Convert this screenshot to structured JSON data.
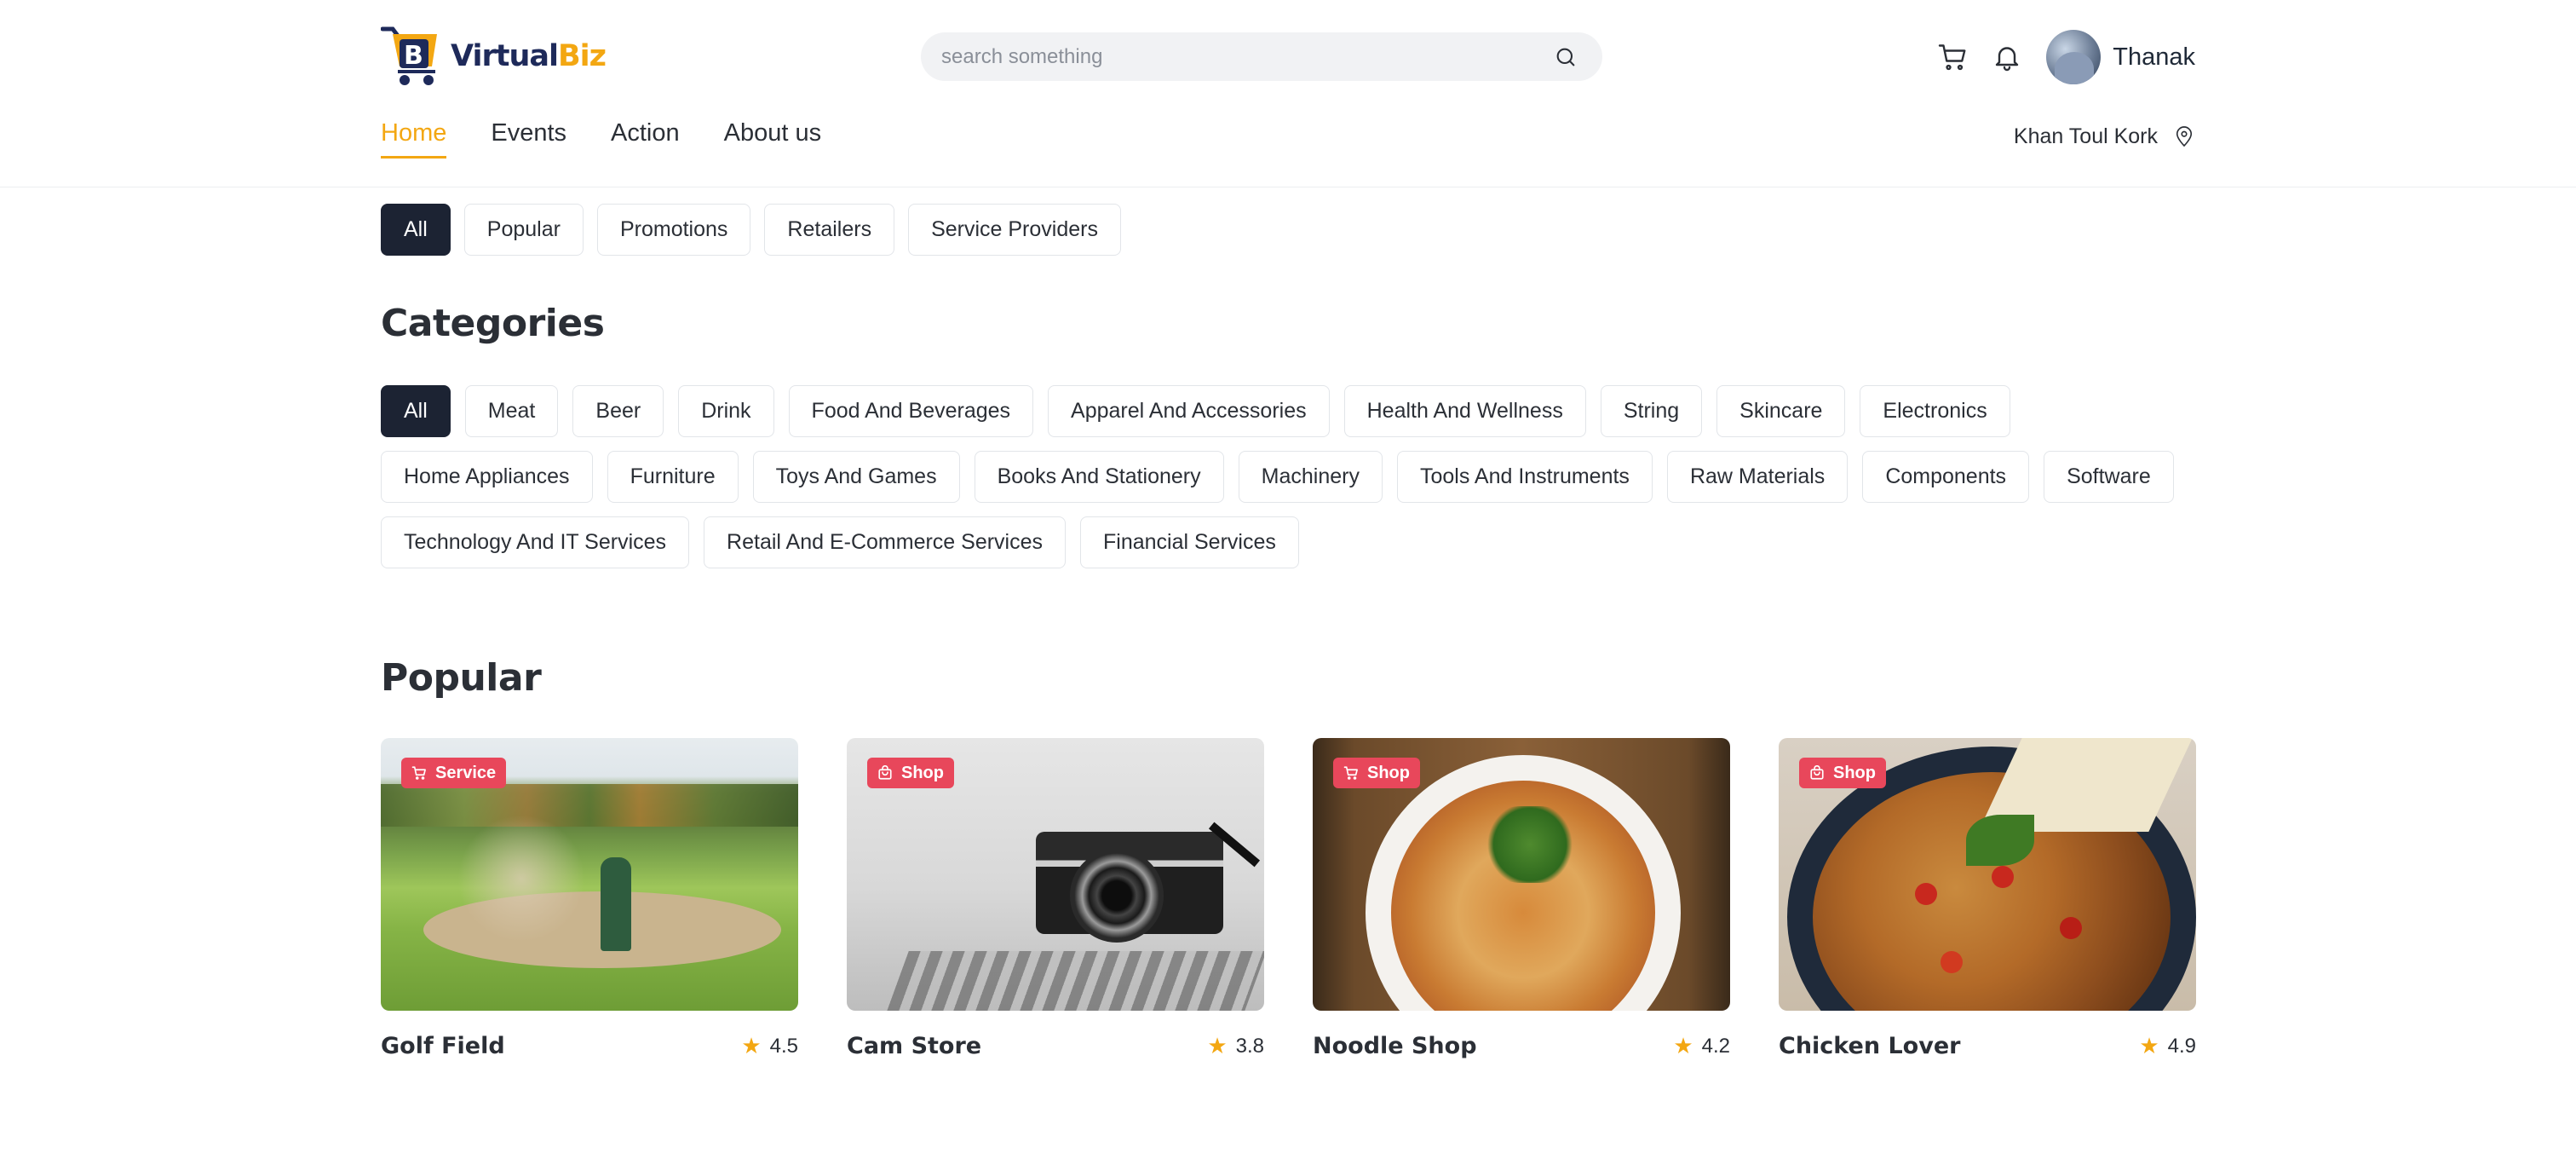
{
  "header": {
    "logo": {
      "part1": "Virtual",
      "part2": "Biz"
    },
    "search": {
      "placeholder": "search something"
    },
    "user": {
      "name": "Thanak"
    },
    "location": "Khan Toul Kork"
  },
  "nav": {
    "items": [
      {
        "label": "Home",
        "active": true
      },
      {
        "label": "Events"
      },
      {
        "label": "Action"
      },
      {
        "label": "About us"
      }
    ]
  },
  "filters": [
    "All",
    "Popular",
    "Promotions",
    "Retailers",
    "Service Providers"
  ],
  "categories": {
    "title": "Categories",
    "items": [
      "All",
      "Meat",
      "Beer",
      "Drink",
      "Food And Beverages",
      "Apparel And Accessories",
      "Health And Wellness",
      "String",
      "Skincare",
      "Electronics",
      "Home Appliances",
      "Furniture",
      "Toys And Games",
      "Books And Stationery",
      "Machinery",
      "Tools And Instruments",
      "Raw Materials",
      "Components",
      "Software",
      "Technology And IT Services",
      "Retail And E-Commerce Services",
      "Financial Services"
    ]
  },
  "popular": {
    "title": "Popular",
    "cards": [
      {
        "name": "Golf Field",
        "badge": "Service",
        "rating": "4.5"
      },
      {
        "name": "Cam Store",
        "badge": "Shop",
        "rating": "3.8"
      },
      {
        "name": "Noodle Shop",
        "badge": "Shop",
        "rating": "4.2"
      },
      {
        "name": "Chicken Lover",
        "badge": "Shop",
        "rating": "4.9"
      }
    ]
  },
  "colors": {
    "accent": "#f3a712",
    "active_chip": "#1c2333",
    "badge": "#e8475b",
    "logo_dark": "#1e2a5a"
  }
}
